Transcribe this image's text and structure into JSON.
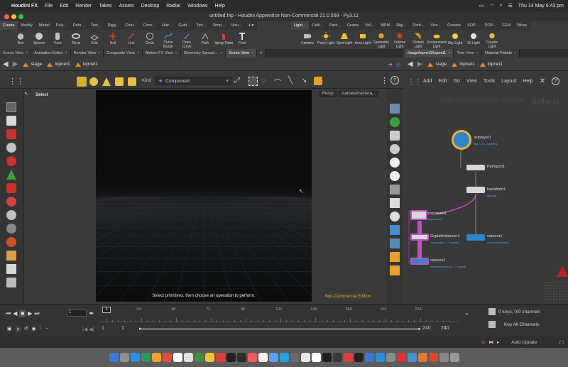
{
  "menubar": {
    "app_name": "Houdini FX",
    "menus": [
      "File",
      "Edit",
      "Render",
      "Takes",
      "Assets",
      "Desktop",
      "Radial",
      "Windows",
      "Help"
    ],
    "clock": "Thu 14 May  6:43 pm"
  },
  "window": {
    "title": "untitled.hip - Houdini Apprentice Non-Commercial 21.0.559 - Py3.11"
  },
  "shelf": {
    "tabs_left": [
      "Create",
      "Modify",
      "Model",
      "Poly...",
      "Defo...",
      "Text...",
      "Rigg...",
      "Char...",
      "Cons...",
      "Hair...",
      "Guid...",
      "Terr...",
      "Simp...",
      "Volu..."
    ],
    "tabs_right": [
      "Light...",
      "Colli...",
      "Parti...",
      "Grains",
      "Vell...",
      "MPM",
      "Rigi...",
      "Parti...",
      "Visc...",
      "Oceans",
      "SOP...",
      "DOP...",
      "FEM",
      "Wires"
    ],
    "tools_left": [
      "Box",
      "Sphere",
      "Tube",
      "Torus",
      "Grid",
      "Null",
      "Line",
      "Circle",
      "Curve Bezier",
      "Draw Curve",
      "Path",
      "Spray Paint",
      "Font"
    ],
    "tools_right": [
      "Camera",
      "Point Light",
      "Spot Light",
      "Area Light",
      "Geometry Light",
      "Volume Light",
      "Distant Light",
      "Environment Light",
      "Sky Light",
      "GI Light",
      "Caustic Light"
    ]
  },
  "left_panes": {
    "tabs": [
      "Scene View",
      "Animation Editor",
      "Render View",
      "Composite View",
      "Motion FX View",
      "Geometry Spread...",
      "Scene View"
    ],
    "path": [
      "stage",
      "lopnet1",
      "lopnet1"
    ],
    "kind_label": "Kind",
    "kind_value": "Component",
    "select_label": "Select",
    "camera_menu": "Persp",
    "camera_path": "/camera/camera...",
    "status_message": "Select primitives, then choose an operation to perform.",
    "edition": "Non-Commercial Edition"
  },
  "right_panes": {
    "tabs": [
      "/stage/lopnet1/lopnet1",
      "Tree View",
      "Material Palette"
    ],
    "path": [
      "stage",
      "lopnet1",
      "lopnet1"
    ],
    "menu": [
      "Add",
      "Edit",
      "Go",
      "View",
      "Tools",
      "Layout",
      "Help"
    ],
    "watermark": "Non-Commercial Edition",
    "context": "Solaris"
  },
  "nodes": [
    {
      "name": "sublayer1",
      "sub": "fps = 24 / /camera"
    },
    {
      "name": "PyImport1",
      "sub": ""
    },
    {
      "name": "transform1",
      "sub": "/geobar"
    },
    {
      "name": "sopcreate1",
      "sub": "/sopcreate1"
    },
    {
      "name": "GsplatInstancer1",
      "sub": "/sopcreate1 / 2 Layers"
    },
    {
      "name": "camera1",
      "sub": "/camera/camera1"
    },
    {
      "name": "camera2",
      "sub": "/camera/camera2 / 2 Layers"
    }
  ],
  "timeline": {
    "ticks": [
      "24",
      "48",
      "72",
      "96",
      "120",
      "144",
      "168",
      "192",
      "216"
    ],
    "current_frame": "1",
    "frame_field": "1",
    "start": "1",
    "start2": "1",
    "end": "240",
    "end2": "240",
    "keys_label": "0 keys, 0/0 channels",
    "channels_label": "Key All Channels",
    "auto_update": "Auto Update"
  },
  "colors": {
    "accent_blue": "#2c86c9",
    "sop_purple": "#8a3d8a",
    "nc_yellow": "#d9b44a"
  }
}
